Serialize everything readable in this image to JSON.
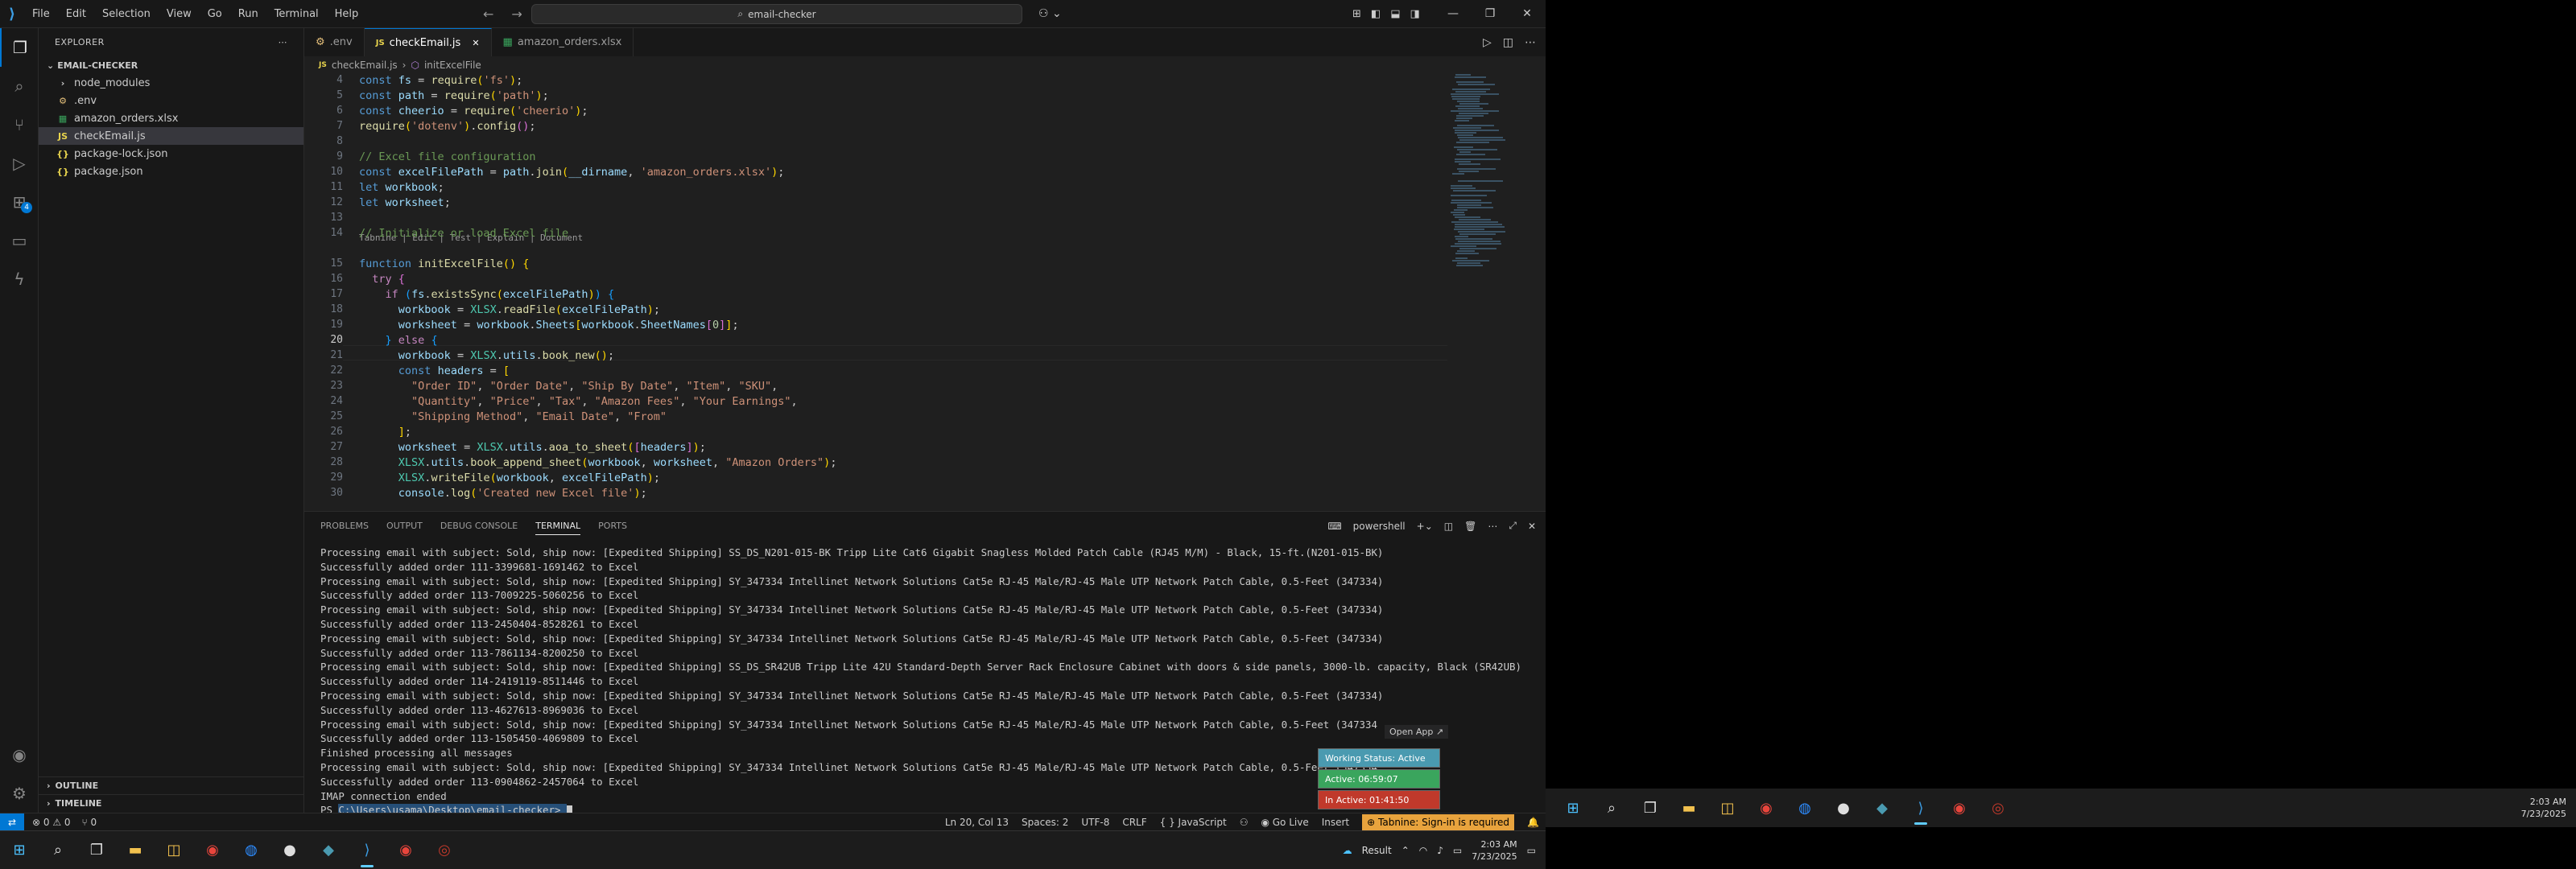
{
  "menu": [
    "File",
    "Edit",
    "Selection",
    "View",
    "Go",
    "Run",
    "Terminal",
    "Help"
  ],
  "search": {
    "text": "email-checker"
  },
  "sidebar": {
    "title": "EXPLORER",
    "folder": "EMAIL-CHECKER",
    "items": [
      {
        "label": "node_modules",
        "icon": "›",
        "color": "#ccc"
      },
      {
        "label": ".env",
        "icon": "⚙",
        "color": "#e5c07b"
      },
      {
        "label": "amazon_orders.xlsx",
        "icon": "▦",
        "color": "#3aa55d"
      },
      {
        "label": "checkEmail.js",
        "icon": "JS",
        "color": "#e8d44d"
      },
      {
        "label": "package-lock.json",
        "icon": "{}",
        "color": "#e8d44d"
      },
      {
        "label": "package.json",
        "icon": "{}",
        "color": "#e8d44d"
      }
    ],
    "outline": "OUTLINE",
    "timeline": "TIMELINE"
  },
  "tabs": [
    {
      "label": ".env",
      "icon": "⚙"
    },
    {
      "label": "checkEmail.js",
      "icon": "JS",
      "close": "✕"
    },
    {
      "label": "amazon_orders.xlsx",
      "icon": "▦"
    }
  ],
  "breadcrumb": {
    "file": "checkEmail.js",
    "symbol": "initExcelFile"
  },
  "code": {
    "line_numbers": [
      "4",
      "5",
      "6",
      "7",
      "8",
      "9",
      "10",
      "11",
      "12",
      "13",
      "14",
      "15",
      "16",
      "17",
      "18",
      "19",
      "20",
      "21",
      "22",
      "23",
      "24",
      "25",
      "26",
      "27",
      "28",
      "29",
      "30"
    ],
    "codelens": "Tabnine | Edit | Test | Explain | Document"
  },
  "panel": {
    "tabs": [
      "PROBLEMS",
      "OUTPUT",
      "DEBUG CONSOLE",
      "TERMINAL",
      "PORTS"
    ],
    "shell": "powershell",
    "lines": [
      "Processing email with subject: Sold, ship now: [Expedited Shipping] SS_DS_N201-015-BK Tripp Lite Cat6 Gigabit Snagless Molded Patch Cable (RJ45 M/M) - Black, 15-ft.(N201-015-BK)",
      "Successfully added order 111-3399681-1691462 to Excel",
      "Processing email with subject: Sold, ship now: [Expedited Shipping] SY_347334 Intellinet Network Solutions Cat5e RJ-45 Male/RJ-45 Male UTP Network Patch Cable, 0.5-Feet (347334)",
      "Successfully added order 113-7009225-5060256 to Excel",
      "Processing email with subject: Sold, ship now: [Expedited Shipping] SY_347334 Intellinet Network Solutions Cat5e RJ-45 Male/RJ-45 Male UTP Network Patch Cable, 0.5-Feet (347334)",
      "Successfully added order 113-2450404-8528261 to Excel",
      "Processing email with subject: Sold, ship now: [Expedited Shipping] SY_347334 Intellinet Network Solutions Cat5e RJ-45 Male/RJ-45 Male UTP Network Patch Cable, 0.5-Feet (347334)",
      "Successfully added order 113-7861134-8200250 to Excel",
      "Processing email with subject: Sold, ship now: [Expedited Shipping] SS_DS_SR42UB Tripp Lite 42U Standard-Depth Server Rack Enclosure Cabinet with doors & side panels, 3000-lb. capacity, Black (SR42UB)",
      "Successfully added order 114-2419119-8511446 to Excel",
      "Processing email with subject: Sold, ship now: [Expedited Shipping] SY_347334 Intellinet Network Solutions Cat5e RJ-45 Male/RJ-45 Male UTP Network Patch Cable, 0.5-Feet (347334)",
      "Successfully added order 113-4627613-8969036 to Excel",
      "Processing email with subject: Sold, ship now: [Expedited Shipping] SY_347334 Intellinet Network Solutions Cat5e RJ-45 Male/RJ-45 Male UTP Network Patch Cable, 0.5-Feet (347334",
      "Successfully added order 113-1505450-4069809 to Excel",
      "Finished processing all messages",
      "Processing email with subject: Sold, ship now: [Expedited Shipping] SY_347334 Intellinet Network Solutions Cat5e RJ-45 Male/RJ-45 Male UTP Network Patch Cable, 0.5-Feet (347334",
      "Successfully added order 113-0904862-2457064 to Excel",
      "IMAP connection ended"
    ],
    "prompt_prefix": "PS ",
    "prompt_path": "C:\\Users\\usama\\Desktop\\email-checker>"
  },
  "toasts": {
    "open_app": "Open App ↗",
    "working": "Working Status: Active",
    "active": "Active: 06:59:07",
    "inactive": "In Active: 01:41:50"
  },
  "colors": {
    "working": "#4a9ab0",
    "active": "#3aa55d",
    "inactive": "#c0392b"
  },
  "status": {
    "errors": "⊗ 0 ⚠ 0",
    "ports": "⑂ 0",
    "position": "Ln 20, Col 13",
    "spaces": "Spaces: 2",
    "encoding": "UTF-8",
    "eol": "CRLF",
    "language": "{ } JavaScript",
    "golive": "◉ Go Live",
    "mode": "Insert",
    "tabnine": "⊕ Tabnine: Sign-in is required"
  },
  "taskbar": {
    "weather": "Result",
    "time": "2:03 AM",
    "date": "7/23/2025"
  }
}
